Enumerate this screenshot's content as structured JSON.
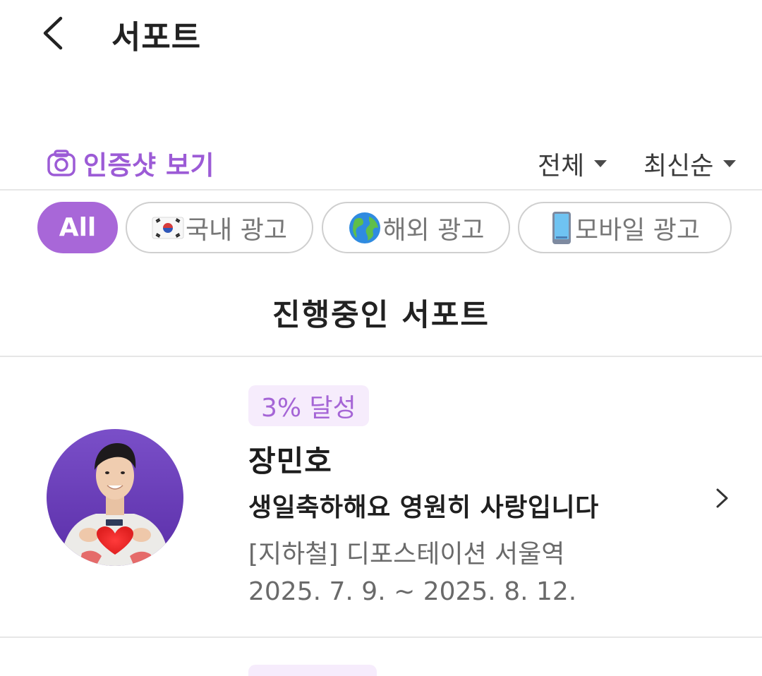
{
  "header": {
    "title": "서포트",
    "back_icon": "chevron-left-icon"
  },
  "toolbar": {
    "proof_label": "인증샷 보기",
    "proof_icon": "camera-icon",
    "filter_label": "전체",
    "sort_label": "최신순"
  },
  "chips": [
    {
      "label": "All",
      "active": true
    },
    {
      "label": "국내 광고",
      "icon": "korea-flag-icon"
    },
    {
      "label": "해외 광고",
      "icon": "globe-icon"
    },
    {
      "label": "모바일 광고",
      "icon": "mobile-phone-icon"
    }
  ],
  "section": {
    "title": "진행중인 서포트"
  },
  "supports": [
    {
      "badge": "3% 달성",
      "progress_percent": 3,
      "name": "장민호",
      "message": "생일축하해요 영원히 사랑입니다",
      "location": "[지하철] 디포스테이션 서울역",
      "period": "2025. 7. 9. ~ 2025. 8. 12."
    }
  ],
  "colors": {
    "accent": "#a867d8",
    "accent_text": "#9c5bd6",
    "badge_bg": "#f6ecfc",
    "divider": "#e6e6e6"
  }
}
